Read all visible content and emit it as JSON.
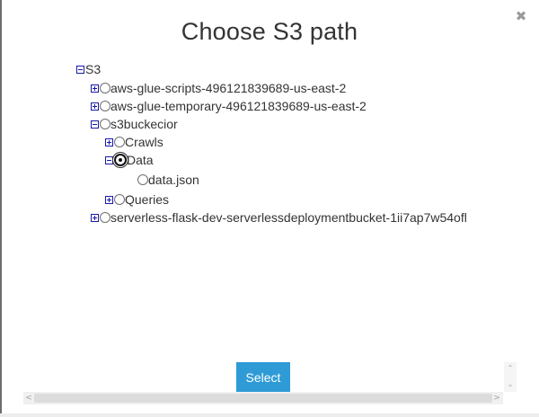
{
  "dialog": {
    "title": "Choose S3 path",
    "close_glyph": "✖",
    "select_label": "Select"
  },
  "tree": {
    "root": "S3",
    "buckets": [
      "aws-glue-scripts-496121839689-us-east-2",
      "aws-glue-temporary-496121839689-us-east-2",
      "s3buckecior",
      "serverless-flask-dev-serverlessdeploymentbucket-1ii7ap7w54ofl"
    ],
    "folders": {
      "crawls": "Crawls",
      "data": "Data",
      "data_file": "data.json",
      "queries": "Queries"
    },
    "selected": "Data"
  },
  "scroll": {
    "up_glyph": "⌃",
    "down_glyph": "⌄",
    "left_glyph": "<",
    "right_glyph": ">"
  },
  "icons": {
    "expand": "plus-square-icon",
    "collapse": "minus-square-icon",
    "radio": "radio-icon",
    "close": "close-icon"
  },
  "colors": {
    "accent": "#2e9bd6",
    "toggle": "#1a1aa6",
    "text": "#333333"
  }
}
